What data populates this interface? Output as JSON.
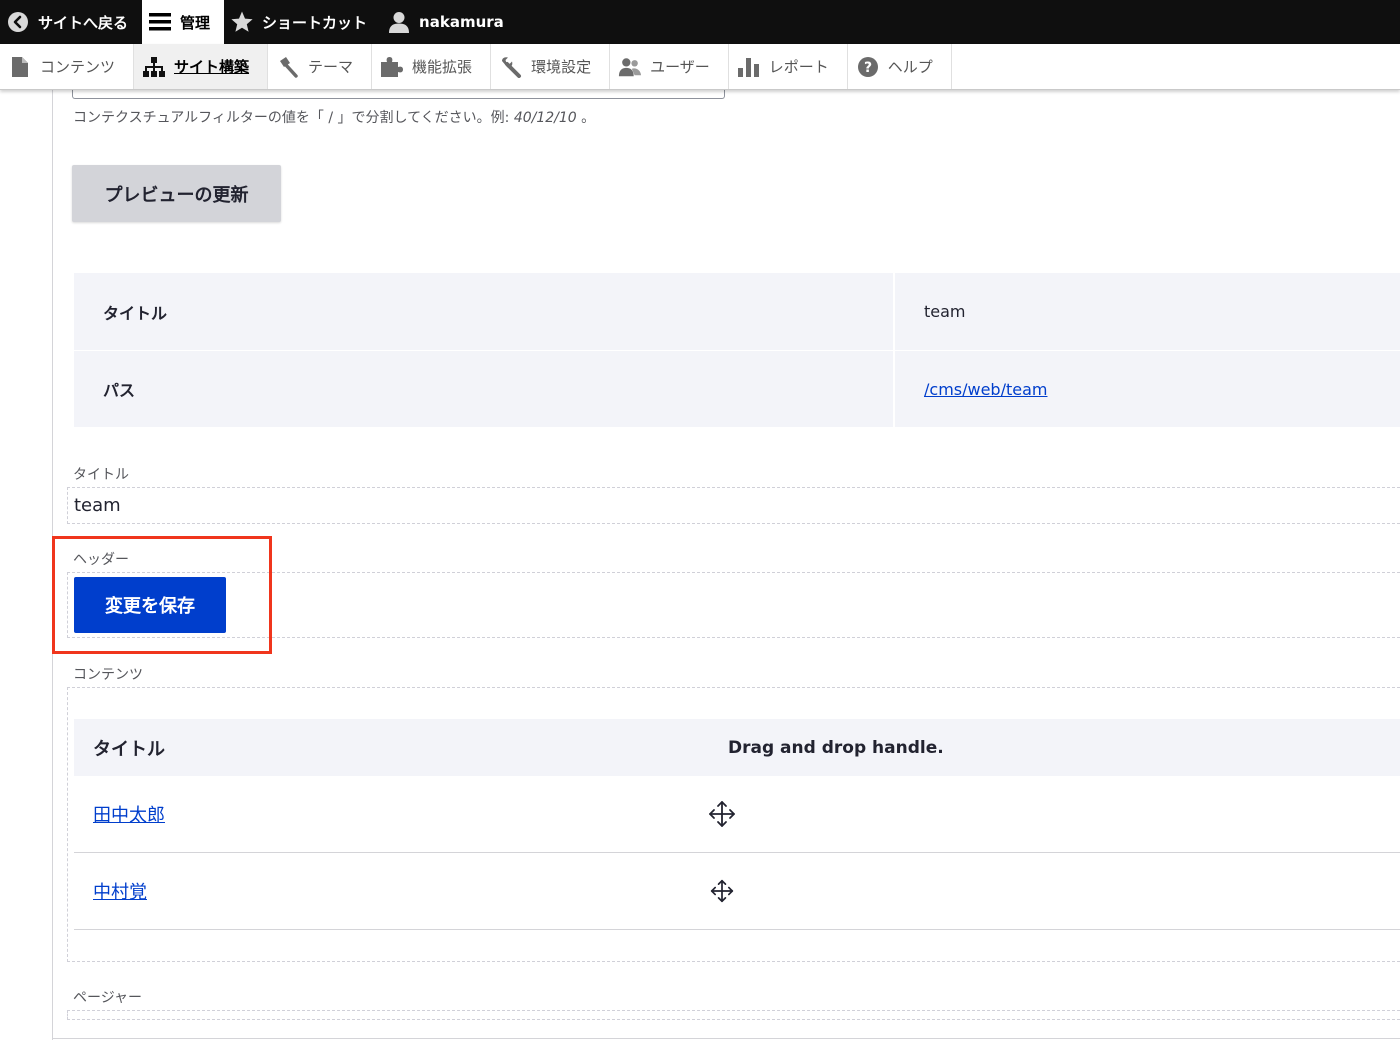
{
  "toolbar": {
    "back_label": "サイトへ戻る",
    "manage_label": "管理",
    "shortcuts_label": "ショートカット",
    "user_label": "nakamura"
  },
  "tray": {
    "items": [
      {
        "label": "コンテンツ",
        "icon": "page-icon"
      },
      {
        "label": "サイト構築",
        "icon": "structure-icon"
      },
      {
        "label": "テーマ",
        "icon": "brush-icon"
      },
      {
        "label": "機能拡張",
        "icon": "puzzle-icon"
      },
      {
        "label": "環境設定",
        "icon": "wrench-icon"
      },
      {
        "label": "ユーザー",
        "icon": "people-icon"
      },
      {
        "label": "レポート",
        "icon": "bar-chart-icon"
      },
      {
        "label": "ヘルプ",
        "icon": "help-icon"
      }
    ],
    "active_index": 1
  },
  "preview": {
    "help_prefix": "コンテクスチュアルフィルターの値を「 / 」で分割してください。例: ",
    "help_example": "40/12/10",
    "help_suffix": " 。",
    "update_button": "プレビューの更新"
  },
  "info_table": {
    "rows": [
      {
        "key": "タイトル",
        "value": "team"
      },
      {
        "key": "パス",
        "value": "/cms/web/team"
      }
    ]
  },
  "view": {
    "title_label": "タイトル",
    "title_value": "team",
    "header_label": "ヘッダー",
    "save_button": "変更を保存",
    "content_label": "コンテンツ",
    "pager_label": "ページャー"
  },
  "content_table": {
    "headers": [
      "タイトル",
      "Drag and drop handle."
    ],
    "rows": [
      {
        "title": "田中太郎"
      },
      {
        "title": "中村覚"
      }
    ]
  },
  "colors": {
    "primary": "#003ecc",
    "highlight": "#f0351c",
    "toolbar_bg": "#0f0f0f"
  }
}
